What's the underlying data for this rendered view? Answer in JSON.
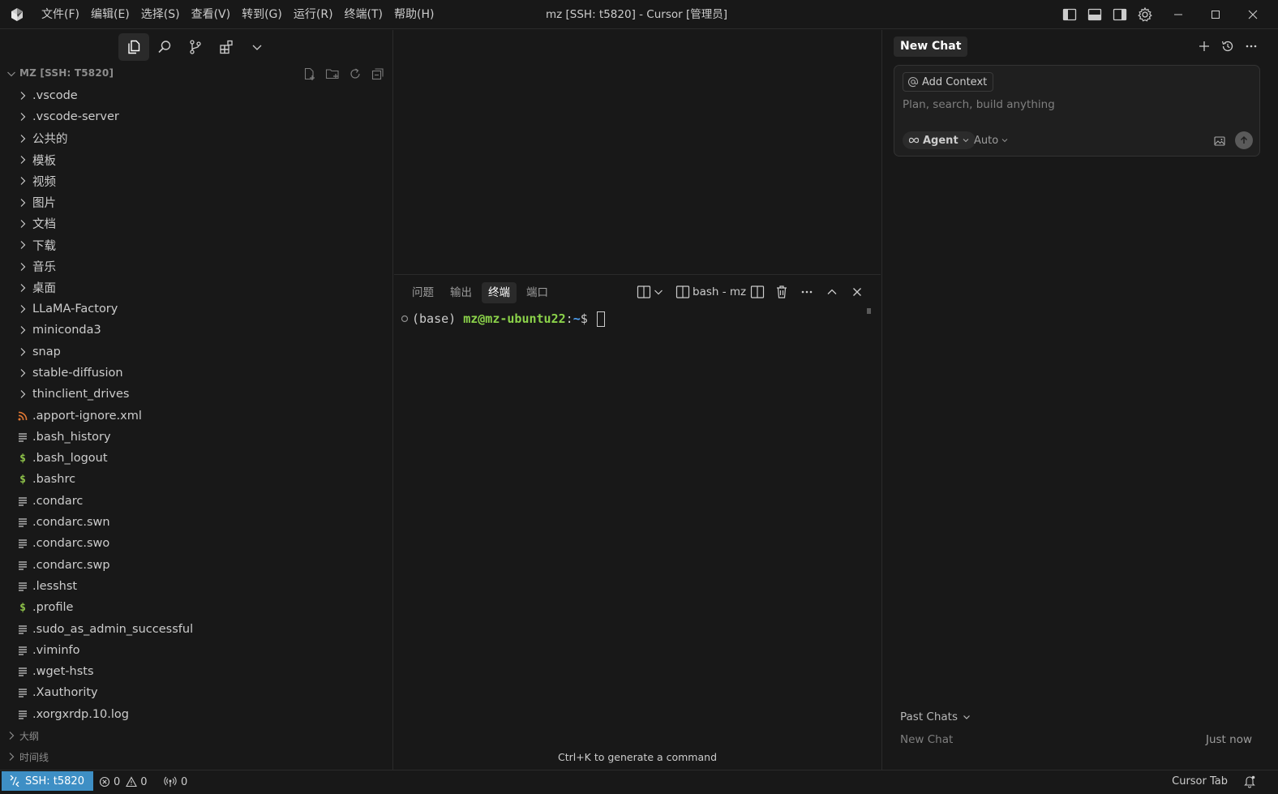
{
  "window": {
    "title": "mz [SSH: t5820] - Cursor [管理员]",
    "menu": [
      "文件(F)",
      "编辑(E)",
      "选择(S)",
      "查看(V)",
      "转到(G)",
      "运行(R)",
      "终端(T)",
      "帮助(H)"
    ]
  },
  "sidebar": {
    "explorer_title": "MZ [SSH: T5820]",
    "folders": [
      ".vscode",
      ".vscode-server",
      "公共的",
      "模板",
      "视频",
      "图片",
      "文档",
      "下载",
      "音乐",
      "桌面",
      "LLaMA-Factory",
      "miniconda3",
      "snap",
      "stable-diffusion",
      "thinclient_drives"
    ],
    "files": [
      {
        "name": ".apport-ignore.xml",
        "icon": "rss-icon"
      },
      {
        "name": ".bash_history",
        "icon": "lines-icon"
      },
      {
        "name": ".bash_logout",
        "icon": "dollar-icon"
      },
      {
        "name": ".bashrc",
        "icon": "dollar-icon"
      },
      {
        "name": ".condarc",
        "icon": "lines-icon"
      },
      {
        "name": ".condarc.swn",
        "icon": "lines-icon"
      },
      {
        "name": ".condarc.swo",
        "icon": "lines-icon"
      },
      {
        "name": ".condarc.swp",
        "icon": "lines-icon"
      },
      {
        "name": ".lesshst",
        "icon": "lines-icon"
      },
      {
        "name": ".profile",
        "icon": "dollar-icon"
      },
      {
        "name": ".sudo_as_admin_successful",
        "icon": "lines-icon"
      },
      {
        "name": ".viminfo",
        "icon": "lines-icon"
      },
      {
        "name": ".wget-hsts",
        "icon": "lines-icon"
      },
      {
        "name": ".Xauthority",
        "icon": "lines-icon"
      },
      {
        "name": ".xorgxrdp.10.log",
        "icon": "lines-icon"
      }
    ],
    "outline_label": "大纲",
    "timeline_label": "时间线"
  },
  "panel": {
    "tabs": [
      "问题",
      "输出",
      "终端",
      "端口"
    ],
    "active_tab": "终端",
    "terminal_name": "bash - mz",
    "prompt_env": "(base) ",
    "prompt_user": "mz@mz-ubuntu22",
    "prompt_sep": ":",
    "prompt_path": "~",
    "prompt_symbol": "$ ",
    "hint": "Ctrl+K to generate a command"
  },
  "chat": {
    "tab_label": "New Chat",
    "add_context": "Add Context",
    "placeholder": "Plan, search, build anything",
    "mode_label": "Agent",
    "model_label": "Auto",
    "past_chats_label": "Past Chats",
    "past_items": [
      {
        "title": "New Chat",
        "time": "Just now"
      }
    ]
  },
  "status": {
    "remote": "SSH: t5820",
    "errors": "0",
    "warnings": "0",
    "ports": "0",
    "cursor_tab": "Cursor Tab"
  },
  "colors": {
    "background": "#181818",
    "remote_badge": "#3e8fc5",
    "prompt_user": "#8bd24a",
    "prompt_path": "#4fa3f7",
    "shell_icon": "#8dc149",
    "xml_icon": "#e37933"
  }
}
